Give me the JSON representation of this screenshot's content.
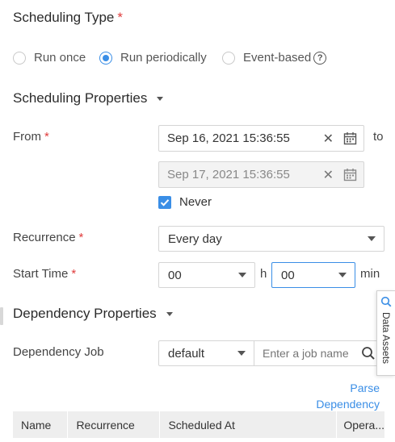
{
  "scheduling_type": {
    "title": "Scheduling Type",
    "required_mark": "*",
    "options": [
      "Run once",
      "Run periodically",
      "Event-based"
    ],
    "selected": "Run periodically",
    "help_glyph": "?"
  },
  "scheduling_properties": {
    "title": "Scheduling Properties",
    "from": {
      "label": "From",
      "required_mark": "*",
      "start_value": "Sep 16, 2021 15:36:55",
      "end_value": "Sep 17, 2021 15:36:55",
      "to_label": "to",
      "clear_glyph": "✕",
      "never_label": "Never",
      "never_checked": true
    },
    "recurrence": {
      "label": "Recurrence",
      "required_mark": "*",
      "value": "Every day"
    },
    "start_time": {
      "label": "Start Time",
      "required_mark": "*",
      "hour_value": "00",
      "hour_unit": "h",
      "minute_value": "00",
      "minute_unit": "min"
    }
  },
  "dependency_properties": {
    "title": "Dependency Properties",
    "job": {
      "label": "Dependency Job",
      "workspace_value": "default",
      "search_placeholder": "Enter a job name"
    },
    "parse_link_line1": "Parse",
    "parse_link_line2": "Dependency",
    "table": {
      "headers": [
        "Name",
        "Recurrence",
        "Scheduled At",
        "Opera..."
      ]
    }
  },
  "side_panel": {
    "label": "Data Assets"
  },
  "colors": {
    "accent": "#3a8ee6",
    "required": "#e03c3c",
    "table_header_bg": "#eeeeee"
  }
}
